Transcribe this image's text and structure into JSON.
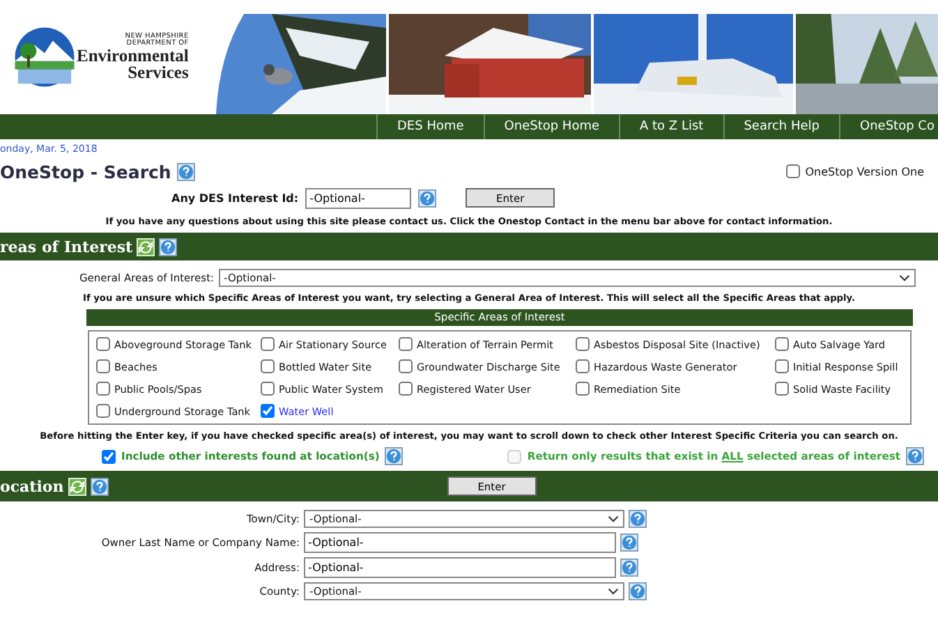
{
  "logo": {
    "lines": [
      "NEW HAMPSHIRE",
      "DEPARTMENT OF"
    ],
    "name_lines": [
      "Environmental",
      "Services"
    ]
  },
  "nav": [
    "DES Home",
    "OneStop Home",
    "A to Z List",
    "Search Help",
    "OneStop Co"
  ],
  "date": "onday, Mar. 5, 2018",
  "page_title": "OneStop - Search",
  "version_one": {
    "label": "OneStop Version One",
    "checked": false
  },
  "interest_id": {
    "label": "Any DES Interest Id:",
    "value": "-Optional-",
    "button": "Enter"
  },
  "contact_note": "If you have any questions about using this site please contact us. Click the Onestop Contact in the menu bar above for contact information.",
  "areas": {
    "title": "reas of Interest",
    "general_label": "General Areas of Interest:",
    "general_value": "-Optional-",
    "hint": "If you are unsure which Specific Areas of Interest you want, try selecting a General Area of Interest. This will select all the Specific Areas that apply.",
    "specific_title": "Specific Areas of Interest",
    "items": [
      {
        "label": "Aboveground Storage Tank",
        "checked": false
      },
      {
        "label": "Air Stationary Source",
        "checked": false
      },
      {
        "label": "Alteration of Terrain Permit",
        "checked": false
      },
      {
        "label": "Asbestos Disposal Site (Inactive)",
        "checked": false
      },
      {
        "label": "Auto Salvage Yard",
        "checked": false
      },
      {
        "label": "Beaches",
        "checked": false
      },
      {
        "label": "Bottled Water Site",
        "checked": false
      },
      {
        "label": "Groundwater Discharge Site",
        "checked": false
      },
      {
        "label": "Hazardous Waste Generator",
        "checked": false
      },
      {
        "label": "Initial Response Spill",
        "checked": false
      },
      {
        "label": "Public Pools/Spas",
        "checked": false
      },
      {
        "label": "Public Water System",
        "checked": false
      },
      {
        "label": "Registered Water User",
        "checked": false
      },
      {
        "label": "Remediation Site",
        "checked": false
      },
      {
        "label": "Solid Waste Facility",
        "checked": false
      },
      {
        "label": "Underground Storage Tank",
        "checked": false
      },
      {
        "label": "Water Well",
        "checked": true
      }
    ]
  },
  "scroll_note": "Before hitting the Enter key, if you have checked specific area(s) of interest, you may want to scroll down to check other Interest Specific Criteria you can search on.",
  "options": [
    {
      "before": "Include other interests found at location(s)",
      "checked": true,
      "disabled": false
    },
    {
      "before": "Return only results that exist in ",
      "underlined": "ALL",
      "after": " selected areas of interest",
      "checked": false,
      "disabled": true
    }
  ],
  "location": {
    "title": "ocation",
    "button": "Enter",
    "fields": [
      {
        "kind": "select",
        "label": "Town/City:",
        "value": "-Optional-"
      },
      {
        "kind": "text",
        "label": "Owner Last Name or Company Name:",
        "value": "-Optional-"
      },
      {
        "kind": "text",
        "label": "Address:",
        "value": "-Optional-"
      },
      {
        "kind": "select",
        "label": "County:",
        "value": "-Optional-"
      }
    ]
  }
}
